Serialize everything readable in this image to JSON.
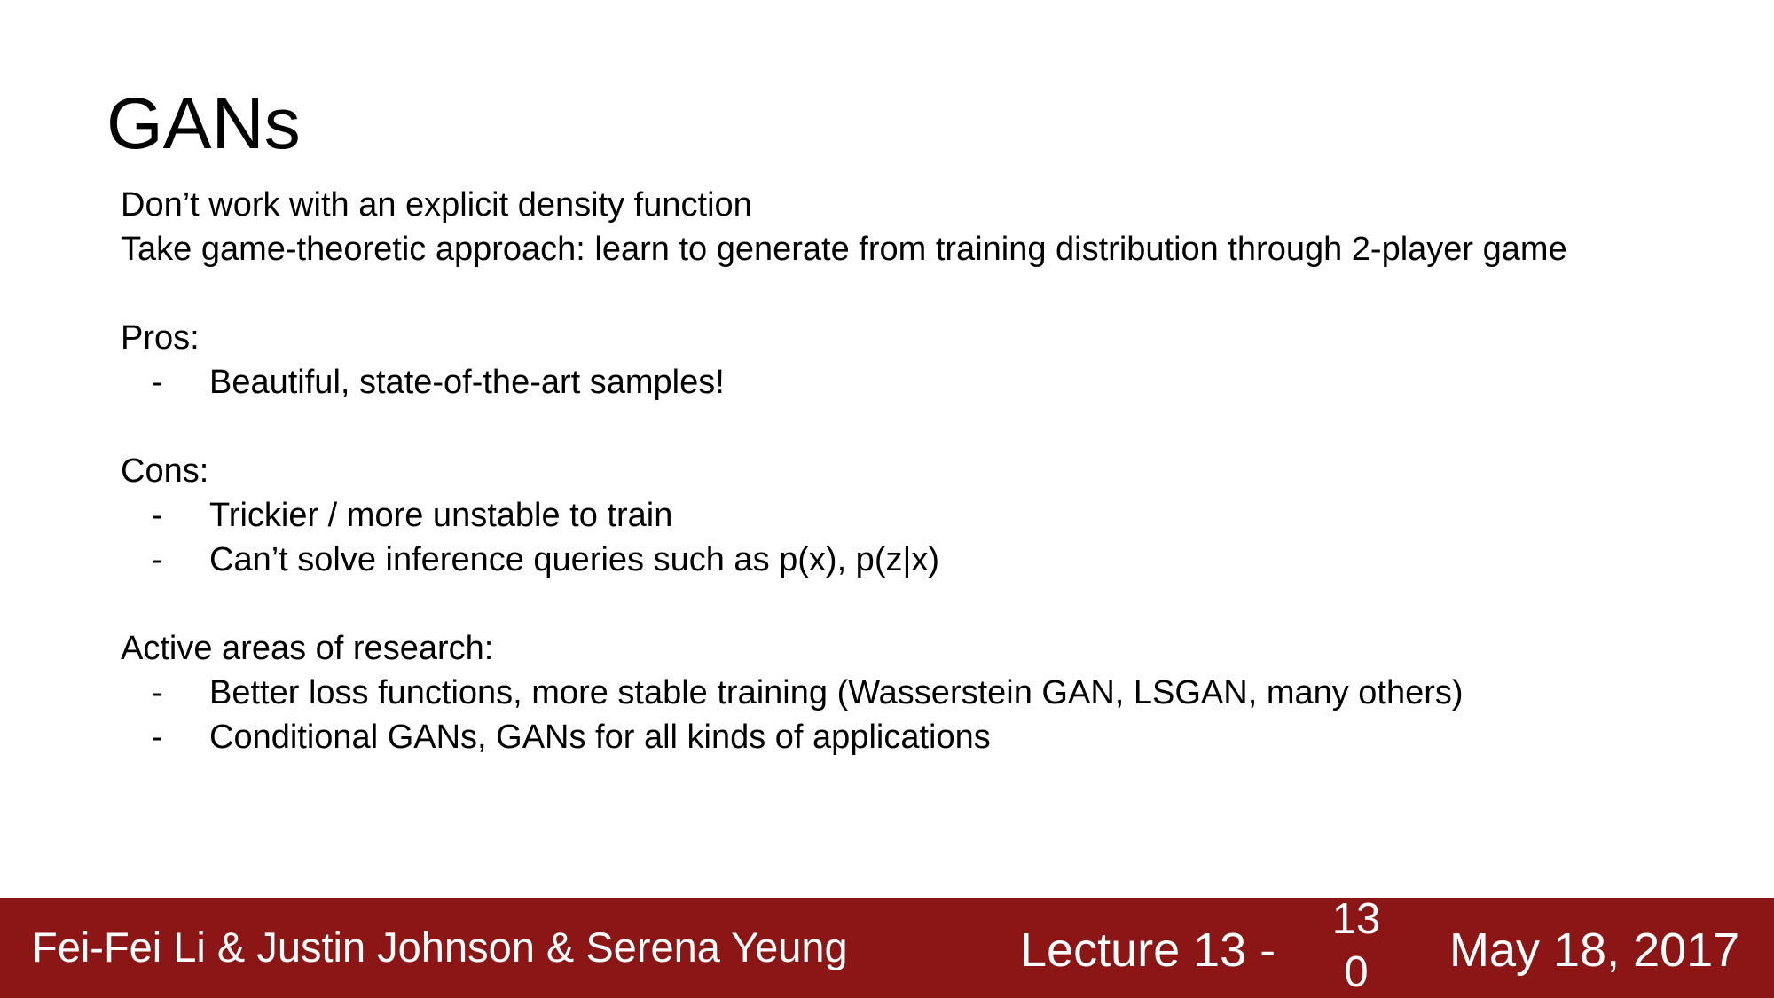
{
  "slide": {
    "title": "GANs",
    "intro": [
      "Don’t work with an explicit density function",
      "Take game-theoretic approach: learn to generate from training distribution through 2-player game"
    ],
    "pros": {
      "heading": "Pros:",
      "items": [
        "Beautiful, state-of-the-art samples!"
      ]
    },
    "cons": {
      "heading": "Cons:",
      "items": [
        "Trickier / more unstable to train",
        "Can’t solve inference queries such as p(x), p(z|x)"
      ]
    },
    "research": {
      "heading": "Active areas of research:",
      "items": [
        "Better loss functions, more stable training (Wasserstein GAN, LSGAN, many others)",
        "Conditional GANs, GANs for all kinds of applications"
      ]
    },
    "bullet_marker": "-"
  },
  "footer": {
    "authors": "Fei-Fei Li & Justin Johnson & Serena Yeung",
    "lecture": "Lecture 13 -",
    "page_number": "130",
    "date": "May 18, 2017",
    "background_color": "#8c1515",
    "text_color": "#ffffff"
  }
}
